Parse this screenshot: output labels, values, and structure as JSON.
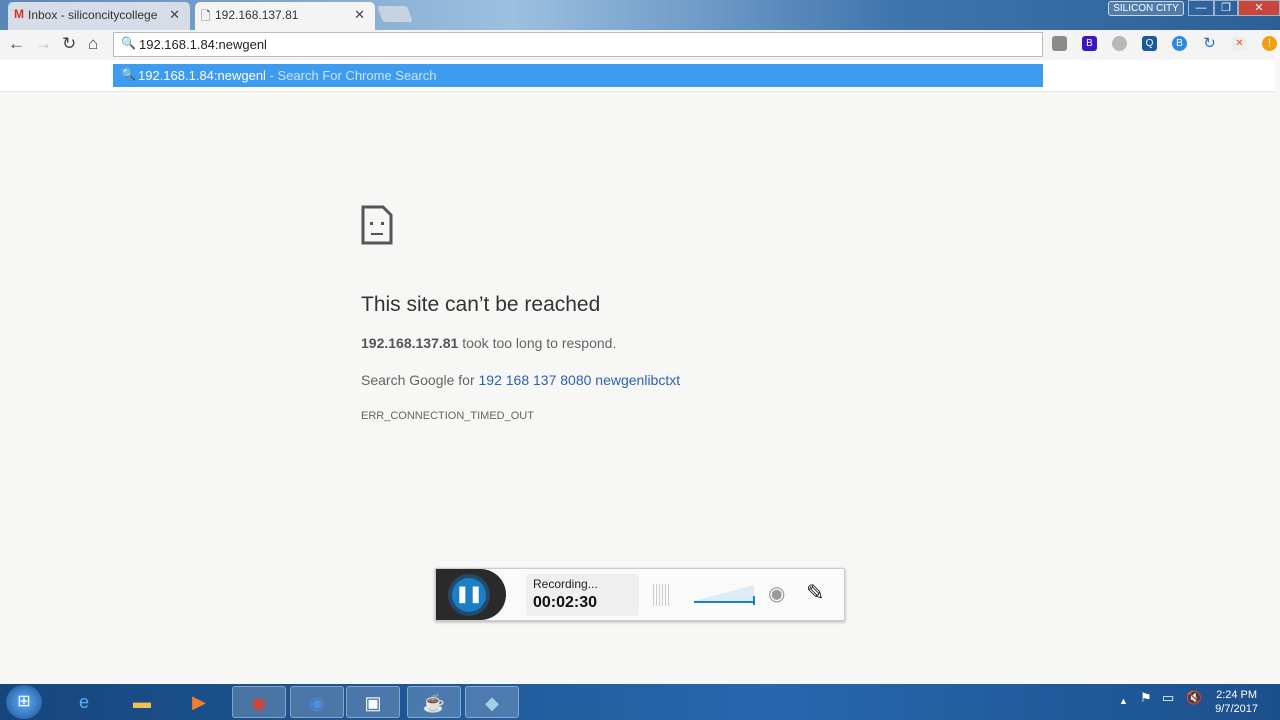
{
  "browser": {
    "tabs": [
      {
        "label": "Inbox - siliconcitycollege",
        "icon": "gmail-icon"
      },
      {
        "label": "192.168.137.81",
        "icon": "page-icon",
        "active": true
      }
    ],
    "profile": "SILICON CITY",
    "omnibox_value": "192.168.1.84:newgenl",
    "suggestion": {
      "text": "192.168.1.84:newgenl",
      "desc": "- Search For Chrome Search"
    },
    "extension_colors": [
      "#8a8a8a",
      "#3b17c4",
      "#b8b8b8",
      "#1a5a9c",
      "#2a8be0",
      "#2a6fd0",
      "#e05a1a",
      "#f0a010"
    ]
  },
  "error": {
    "title": "This site can’t be reached",
    "host": "192.168.137.81",
    "message": "took too long to respond.",
    "search_prefix": "Search Google for",
    "search_link": "192 168 137 8080 newgenlibctxt",
    "code": "ERR_CONNECTION_TIMED_OUT"
  },
  "recorder": {
    "status": "Recording...",
    "time": "00:02:30",
    "accent": "#1a7fc4"
  },
  "taskbar": {
    "time": "2:24 PM",
    "date": "9/7/2017"
  }
}
